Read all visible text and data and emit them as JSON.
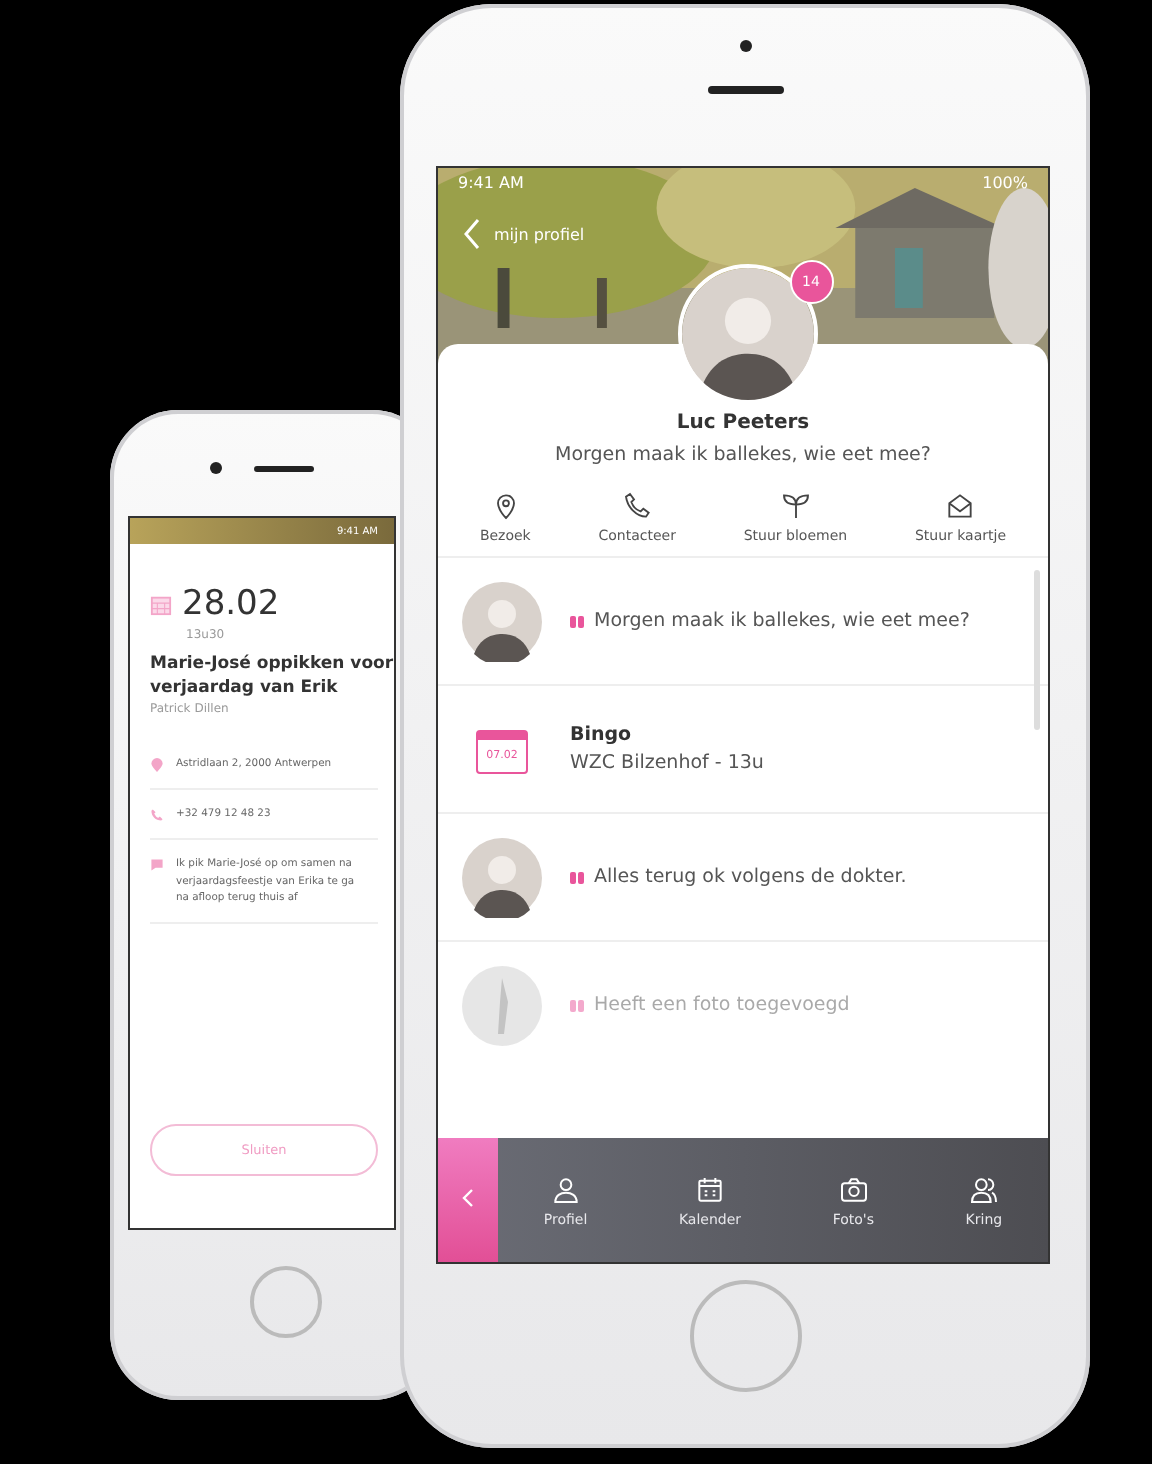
{
  "back_phone": {
    "status_bar": {
      "time": "9:41 AM"
    },
    "appointment": {
      "date": "28.02",
      "time": "13u30",
      "title": "Marie-José oppikken voor verjaardag van Erik",
      "author": "Patrick Dillen",
      "details": [
        {
          "kind": "address",
          "text": "Astridlaan 2, 2000 Antwerpen"
        },
        {
          "kind": "phone",
          "text": "+32 479 12 48 23"
        },
        {
          "kind": "note",
          "lines": [
            "Ik pik Marie-José op om samen na",
            "verjaardagsfeestje van Erika te ga",
            "na afloop terug thuis af"
          ]
        }
      ],
      "close_button": "Sluiten"
    }
  },
  "front_phone": {
    "status_bar": {
      "time": "9:41 AM",
      "battery": "100%"
    },
    "header": {
      "back_label": "mijn profiel",
      "badge": "14"
    },
    "profile": {
      "name": "Luc Peeters",
      "status": "Morgen maak ik ballekes, wie eet mee?"
    },
    "actions": [
      {
        "kind": "pin",
        "label": "Bezoek"
      },
      {
        "kind": "phone",
        "label": "Contacteer"
      },
      {
        "kind": "plant",
        "label": "Stuur bloemen"
      },
      {
        "kind": "envelope",
        "label": "Stuur kaartje"
      }
    ],
    "feed": [
      {
        "kind": "quote",
        "text": "Morgen maak ik ballekes, wie eet mee?",
        "faded": false
      },
      {
        "kind": "event",
        "date": "07.02",
        "title": "Bingo",
        "text": "WZC Bilzenhof - 13u",
        "faded": false
      },
      {
        "kind": "quote",
        "text": "Alles terug ok volgens de dokter.",
        "faded": false
      },
      {
        "text": "Heeft een foto toegevoegd",
        "faded": true
      }
    ],
    "nav": [
      {
        "kind": "person",
        "label": "Profiel",
        "selected": false
      },
      {
        "kind": "calendar",
        "label": "Kalender",
        "selected": false
      },
      {
        "kind": "camera",
        "label": "Foto's",
        "selected": false
      },
      {
        "kind": "group",
        "label": "Kring",
        "selected": false
      }
    ]
  }
}
